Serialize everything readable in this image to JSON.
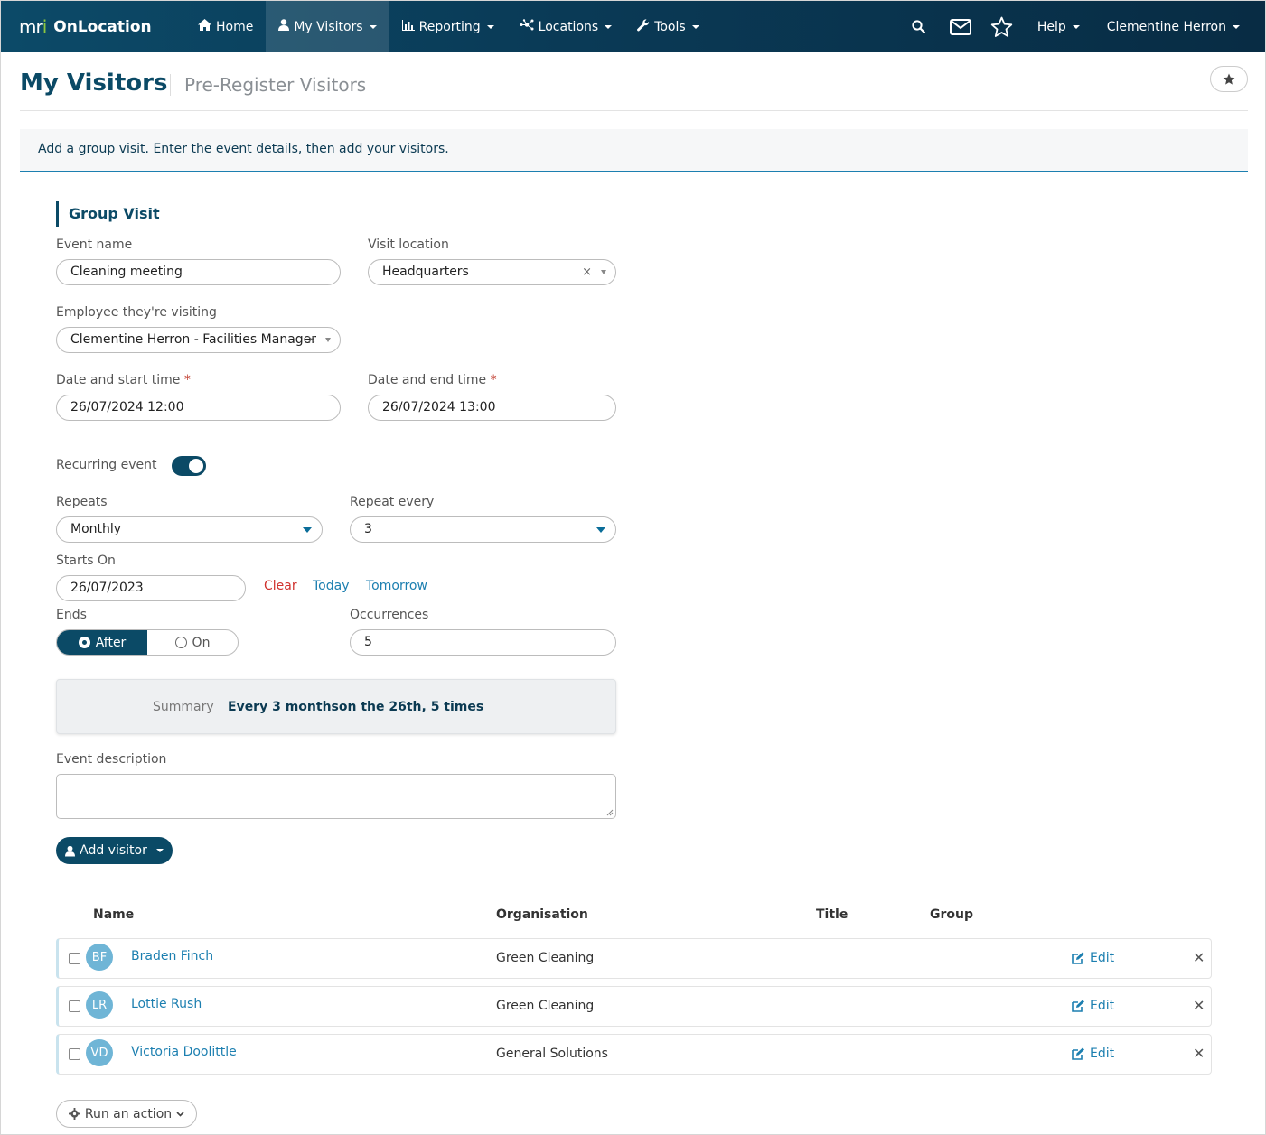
{
  "brand": {
    "mark_a": "m",
    "mark_b": "r",
    "mark_c": "i",
    "name": "OnLocation"
  },
  "nav": {
    "items": [
      {
        "label": "Home",
        "icon": "home-icon"
      },
      {
        "label": "My Visitors",
        "icon": "user-icon",
        "active": true
      },
      {
        "label": "Reporting",
        "icon": "bar-chart-icon"
      },
      {
        "label": "Locations",
        "icon": "network-icon"
      },
      {
        "label": "Tools",
        "icon": "wrench-icon"
      }
    ],
    "help": "Help",
    "user": "Clementine Herron"
  },
  "header": {
    "title": "My Visitors",
    "subtitle": "Pre-Register Visitors"
  },
  "info": "Add a group visit. Enter the event details, then add your visitors.",
  "form": {
    "section_title": "Group Visit",
    "event_name_label": "Event name",
    "event_name_value": "Cleaning meeting",
    "visit_location_label": "Visit location",
    "visit_location_value": "Headquarters",
    "employee_label": "Employee they're visiting",
    "employee_value": "Clementine Herron - Facilities Manager",
    "start_label": "Date and start time",
    "start_value": "26/07/2024 12:00",
    "end_label": "Date and end time",
    "end_value": "26/07/2024 13:00",
    "required_mark": "*",
    "recurring_label": "Recurring event",
    "repeats_label": "Repeats",
    "repeats_value": "Monthly",
    "repeat_every_label": "Repeat every",
    "repeat_every_value": "3",
    "starts_on_label": "Starts On",
    "starts_on_value": "26/07/2023",
    "clear": "Clear",
    "today": "Today",
    "tomorrow": "Tomorrow",
    "ends_label": "Ends",
    "ends_after": "After",
    "ends_on": "On",
    "occurrences_label": "Occurrences",
    "occurrences_value": "5",
    "summary_label": "Summary",
    "summary_value": "Every 3 monthson the 26th, 5 times",
    "description_label": "Event description",
    "add_visitor": "Add visitor"
  },
  "table": {
    "headers": {
      "name": "Name",
      "organisation": "Organisation",
      "title": "Title",
      "group": "Group"
    },
    "edit_label": "Edit",
    "delete_glyph": "✕",
    "rows": [
      {
        "initials": "BF",
        "name": "Braden Finch",
        "organisation": "Green Cleaning"
      },
      {
        "initials": "LR",
        "name": "Lottie Rush",
        "organisation": "Green Cleaning"
      },
      {
        "initials": "VD",
        "name": "Victoria Doolittle",
        "organisation": "General Solutions"
      }
    ]
  },
  "run_action": "Run an action",
  "colors": {
    "primary": "#0b4a66",
    "link": "#1c7fb0",
    "accent": "#8cc63f",
    "danger": "#d0312d"
  }
}
